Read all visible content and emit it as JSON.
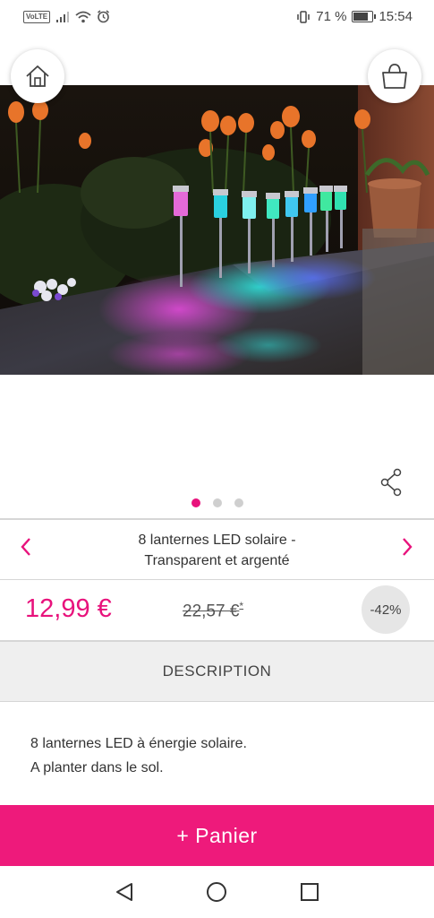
{
  "status_bar": {
    "carrier_badge": "VoLTE",
    "battery_percent": "71 %",
    "battery_level": 0.71,
    "time": "15:54",
    "icons": [
      "signal-icon",
      "wifi-icon",
      "alarm-icon",
      "vibrate-icon",
      "battery-icon"
    ]
  },
  "header": {
    "home_icon": "home-icon",
    "cart_icon": "shopping-bag-icon"
  },
  "gallery": {
    "image_count": 3,
    "active_index": 0,
    "share_icon": "share-icon"
  },
  "product": {
    "title_line1": "8 lanternes LED solaire -",
    "title_line2": "Transparent et argenté",
    "price": "12,99 €",
    "old_price": "22,57 €",
    "old_price_mark": "*",
    "discount": "-42%"
  },
  "description": {
    "tab_label": "DESCRIPTION",
    "line1": "8 lanternes LED à énergie solaire.",
    "line2": "A planter dans le sol."
  },
  "cta": {
    "add_to_cart": "+ Panier"
  },
  "colors": {
    "accent": "#e8127c",
    "button": "#ee1a7b"
  }
}
